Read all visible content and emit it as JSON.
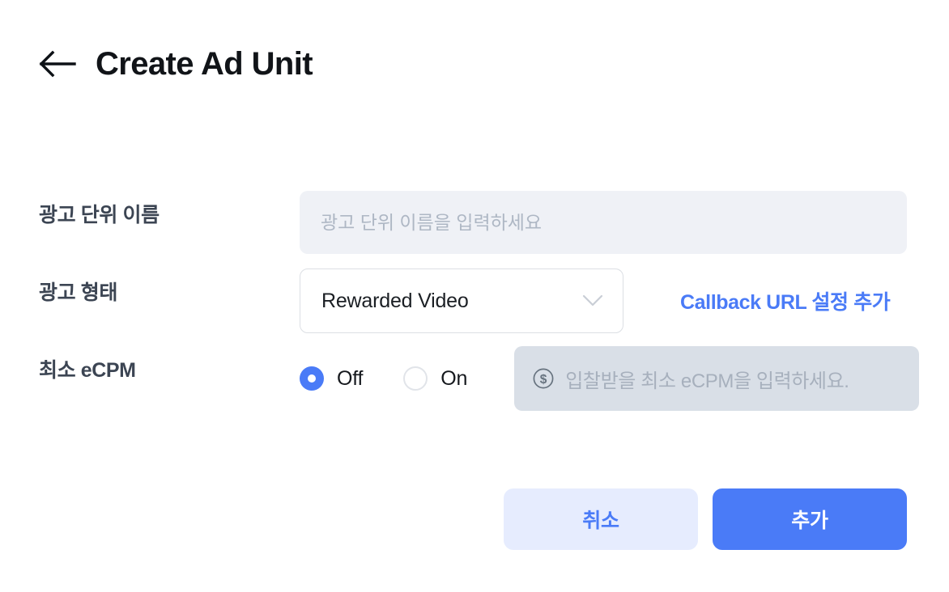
{
  "header": {
    "back_icon": "arrow-left-icon",
    "title": "Create Ad Unit"
  },
  "form": {
    "name_field": {
      "label": "광고 단위 이름",
      "value": "",
      "placeholder": "광고 단위 이름을 입력하세요"
    },
    "type_field": {
      "label": "광고 형태",
      "selected": "Rewarded Video",
      "options": [
        "Rewarded Video"
      ],
      "chevron_icon": "chevron-down-icon",
      "callback_link": "Callback URL 설정 추가"
    },
    "ecpm_field": {
      "label": "최소 eCPM",
      "radio_off": "Off",
      "radio_on": "On",
      "selected": "Off",
      "currency_icon": "dollar-circle-icon",
      "value": "",
      "placeholder": "입찰받을 최소 eCPM을 입력하세요.",
      "disabled": true
    }
  },
  "footer": {
    "cancel_label": "취소",
    "submit_label": "추가"
  },
  "colors": {
    "accent": "#4a7bf7",
    "accent_soft": "#e6ecfe",
    "input_bg": "#eff1f6",
    "input_disabled_bg": "#d9dfe7",
    "label": "#3c4553",
    "placeholder": "#aeb7c4",
    "title": "#111418",
    "border": "#dcdfe4",
    "page_bg": "#ffffff"
  }
}
